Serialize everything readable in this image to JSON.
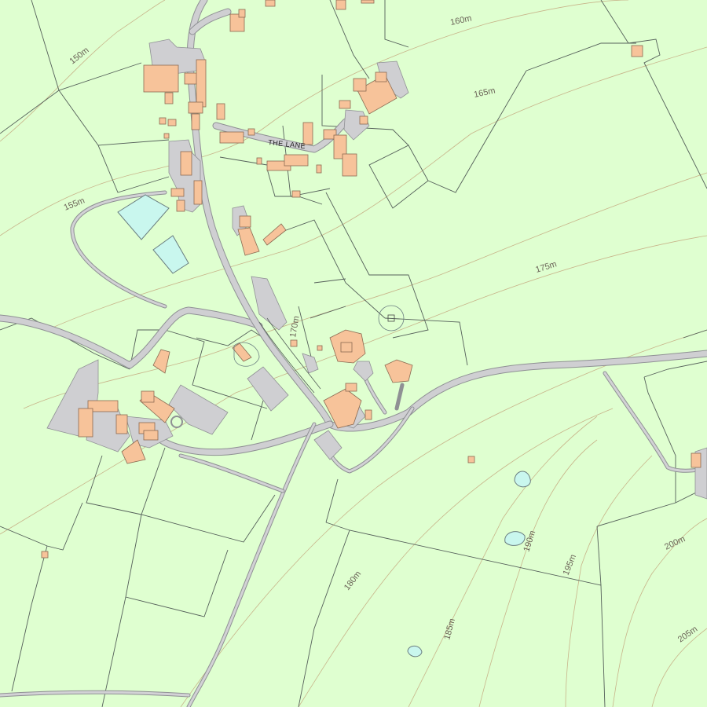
{
  "contour_labels": {
    "c150": "150m",
    "c155": "155m",
    "c160": "160m",
    "c165": "165m",
    "c170": "170m",
    "c175": "175m",
    "c180": "180m",
    "c185": "185m",
    "c190": "190m",
    "c195": "195m",
    "c200": "200m",
    "c205": "205m"
  },
  "road_labels": {
    "the_lane": "THE LANE"
  },
  "colors": {
    "land": "#dfffd0",
    "building": "#f7c39a",
    "road": "#cfcfd2",
    "water": "#c9f7ee",
    "contour": "#c8b48a",
    "boundary": "#55605a"
  }
}
